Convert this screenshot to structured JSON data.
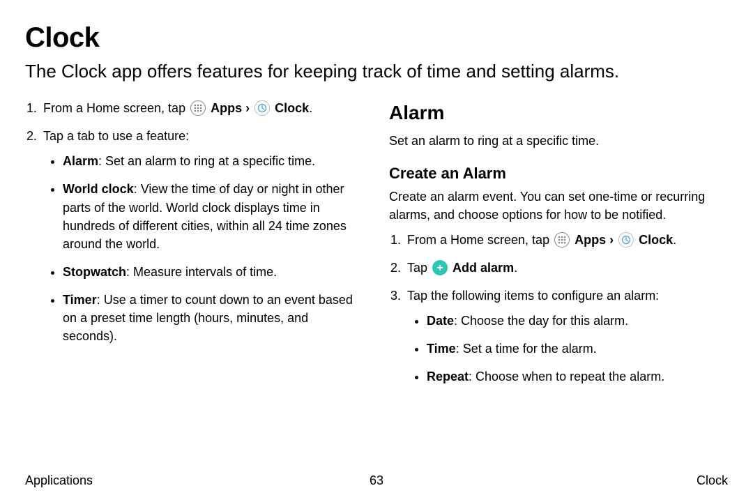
{
  "title": "Clock",
  "subtitle": "The Clock app offers features for keeping track of time and setting alarms.",
  "left": {
    "step1_prefix": "From a Home screen, tap ",
    "apps_label": "Apps",
    "chevron": "›",
    "clock_label": "Clock",
    "period": ".",
    "step2": "Tap a tab to use a feature:",
    "features": [
      {
        "name": "Alarm",
        "desc": ": Set an alarm to ring at a specific time."
      },
      {
        "name": "World clock",
        "desc": ": View the time of day or night in other parts of the world. World clock displays time in hundreds of different cities, within all 24 time zones around the world."
      },
      {
        "name": "Stopwatch",
        "desc": ": Measure intervals of time."
      },
      {
        "name": "Timer",
        "desc": ": Use a timer to count down to an event based on a preset time length (hours, minutes, and seconds)."
      }
    ]
  },
  "right": {
    "heading": "Alarm",
    "intro": "Set an alarm to ring at a specific time.",
    "subheading": "Create an Alarm",
    "subintro": "Create an alarm event. You can set one-time or recurring alarms, and choose options for how to be notified.",
    "step1_prefix": "From a Home screen, tap ",
    "apps_label": "Apps",
    "chevron": "›",
    "clock_label": "Clock",
    "period": ".",
    "step2_prefix": "Tap ",
    "add_alarm_label": "Add alarm",
    "step2_suffix": ".",
    "step3": "Tap the following items to configure an alarm:",
    "configs": [
      {
        "name": "Date",
        "desc": ": Choose the day for this alarm."
      },
      {
        "name": "Time",
        "desc": ": Set a time for the alarm."
      },
      {
        "name": "Repeat",
        "desc": ": Choose when to repeat the alarm."
      }
    ]
  },
  "footer": {
    "left": "Applications",
    "center": "63",
    "right": "Clock"
  }
}
